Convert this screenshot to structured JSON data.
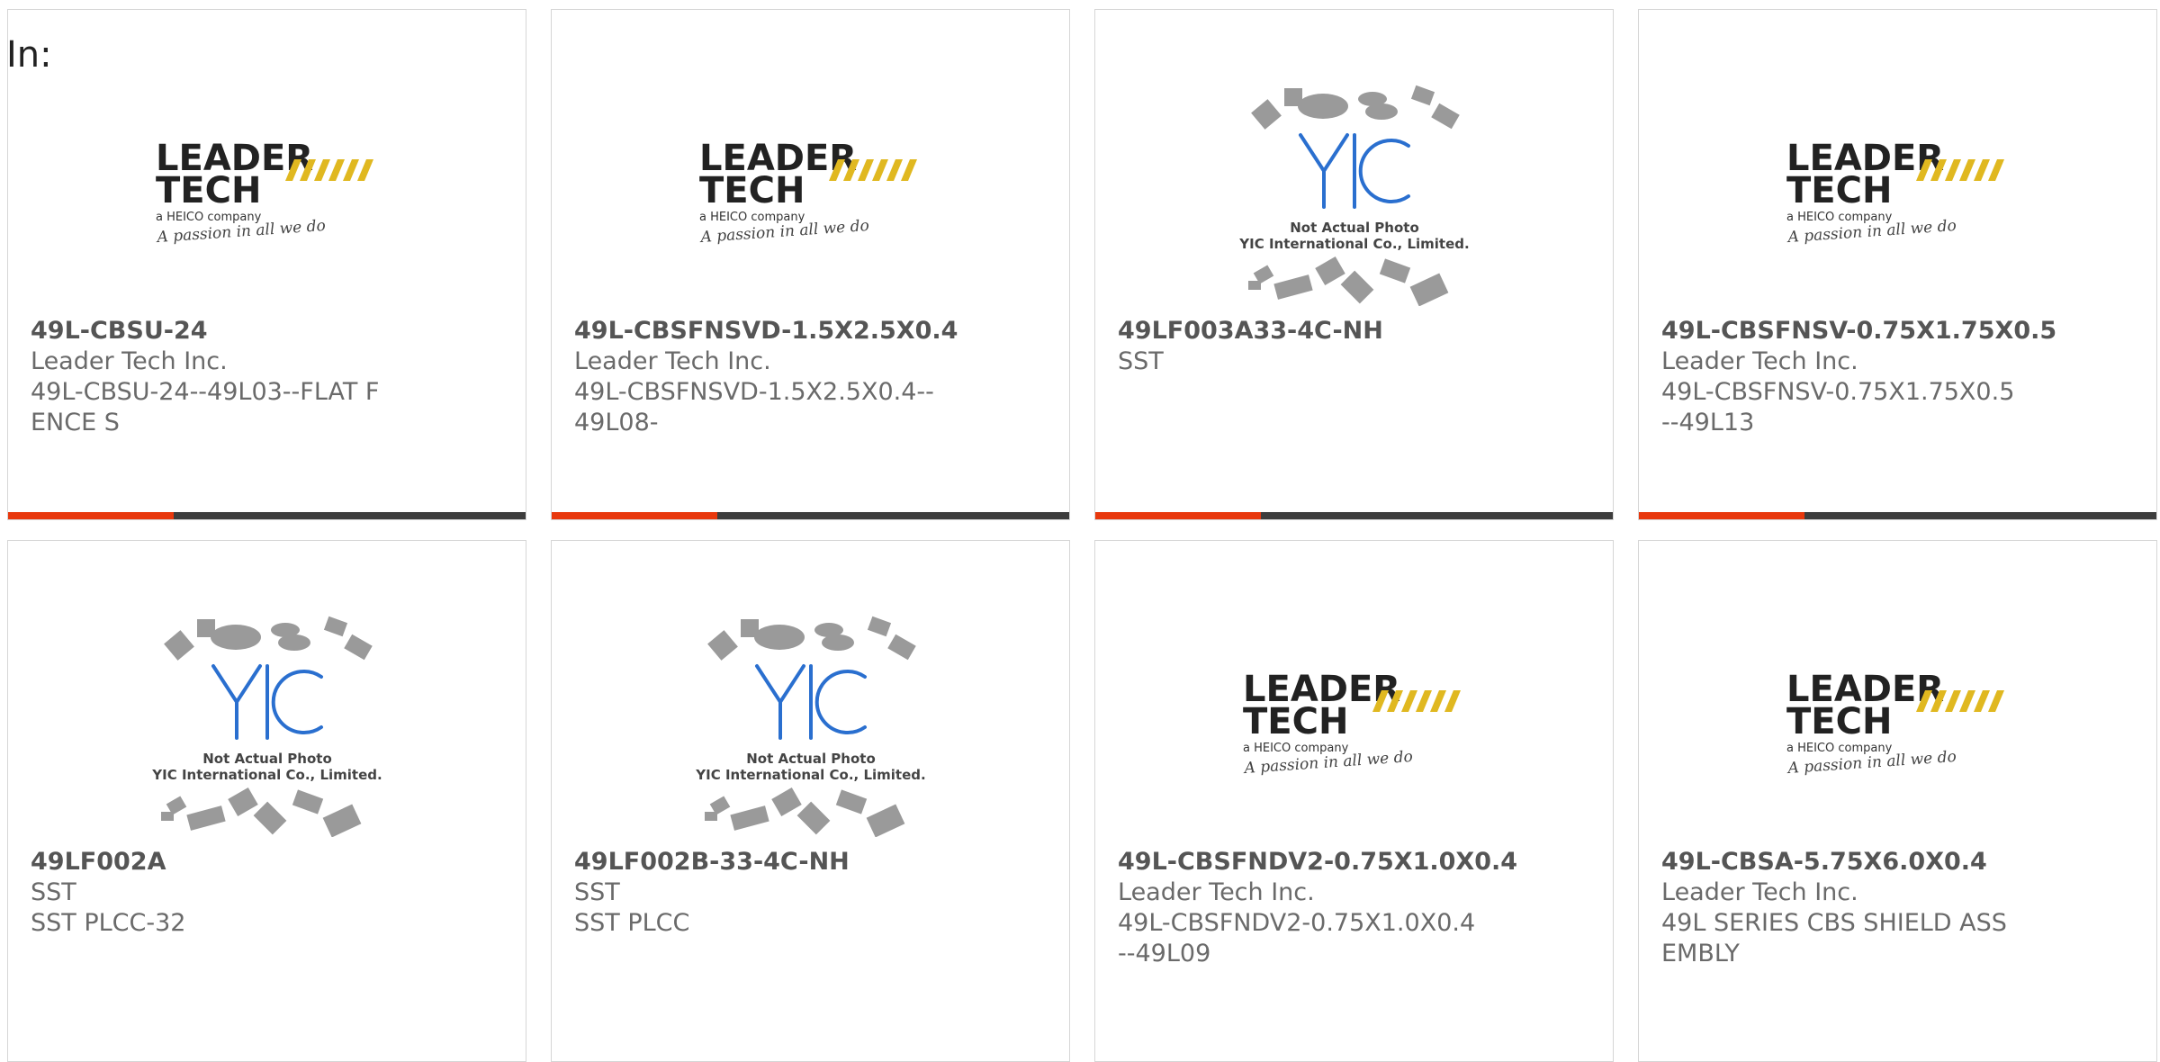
{
  "page": {
    "in_label": "In:"
  },
  "products": [
    {
      "part_number": "49L-CBSU-24",
      "manufacturer": "Leader Tech Inc.",
      "description": "49L-CBSU-24--49L03--FLAT FENCE S",
      "logo": "leader-tech-logo",
      "progress_fraction": 0.32
    },
    {
      "part_number": "49L-CBSFNSVD-1.5X2.5X0.4",
      "manufacturer": "Leader Tech Inc.",
      "description": "49L-CBSFNSVD-1.5X2.5X0.4--49L08-",
      "logo": "leader-tech-logo",
      "progress_fraction": 0.32
    },
    {
      "part_number": "49LF003A33-4C-NH",
      "manufacturer": "SST",
      "description": "",
      "logo": "yic-not-actual-photo",
      "progress_fraction": 0.32
    },
    {
      "part_number": "49L-CBSFNSV-0.75X1.75X0.5",
      "manufacturer": "Leader Tech Inc.",
      "description": "49L-CBSFNSV-0.75X1.75X0.5--49L13",
      "logo": "leader-tech-logo",
      "progress_fraction": 0.32
    },
    {
      "part_number": "49LF002A",
      "manufacturer": "SST",
      "description": "SST PLCC-32",
      "logo": "yic-not-actual-photo"
    },
    {
      "part_number": "49LF002B-33-4C-NH",
      "manufacturer": "SST",
      "description": "SST PLCC",
      "logo": "yic-not-actual-photo"
    },
    {
      "part_number": "49L-CBSFNDV2-0.75X1.0X0.4",
      "manufacturer": "Leader Tech Inc.",
      "description": "49L-CBSFNDV2-0.75X1.0X0.4--49L09",
      "logo": "leader-tech-logo"
    },
    {
      "part_number": "49L-CBSA-5.75X6.0X0.4",
      "manufacturer": "Leader Tech Inc.",
      "description": "49L SERIES CBS SHIELD ASSEMBLY",
      "logo": "leader-tech-logo"
    }
  ],
  "logos": {
    "leader": {
      "line1": "LEADER",
      "line2": "TECH",
      "tagline": "a HEICO company",
      "slogan": "A passion in all we do"
    },
    "yic": {
      "mark": "YIC",
      "line1": "Not Actual Photo",
      "line2": "YIC International Co., Limited."
    }
  },
  "colors": {
    "accent": "#e8380d",
    "bar": "#3d3d3d",
    "border": "#d6d6d6",
    "logo_gold": "#e0b820"
  }
}
